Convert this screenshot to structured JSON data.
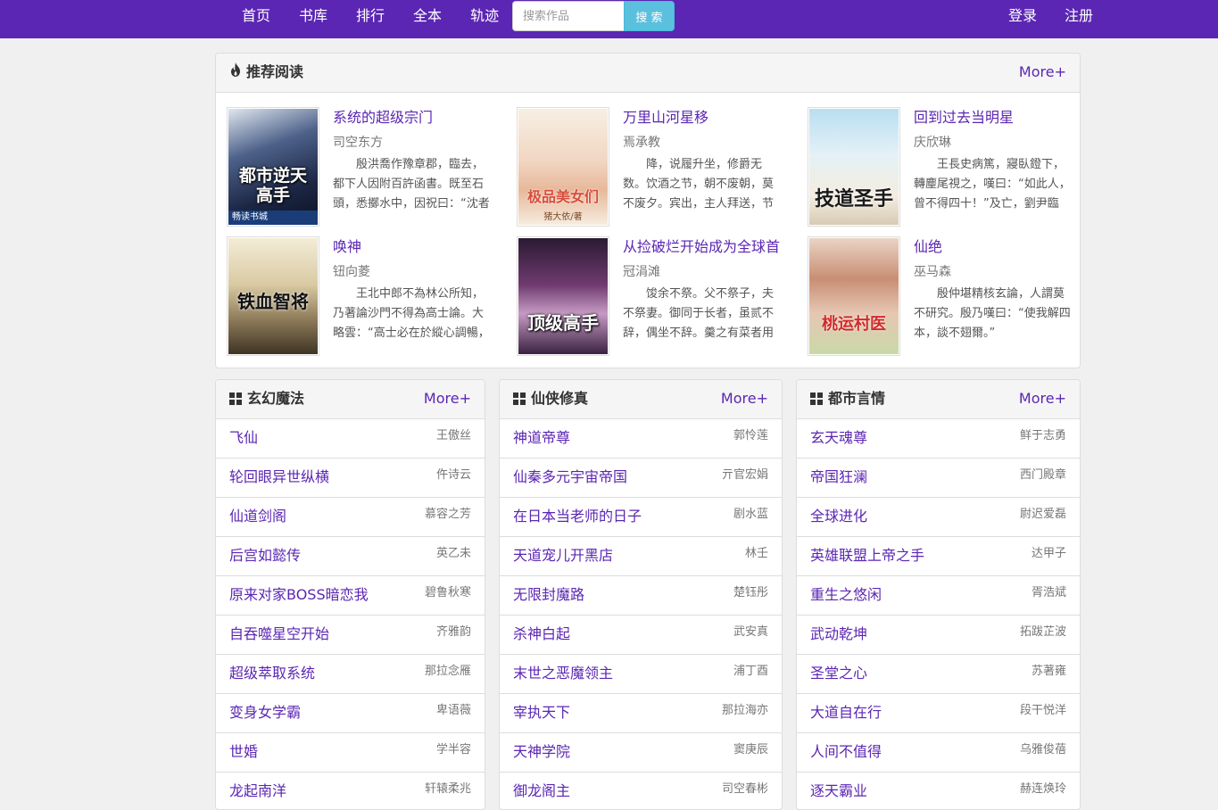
{
  "nav": {
    "items": [
      "首页",
      "书库",
      "排行",
      "全本",
      "轨迹"
    ],
    "search_placeholder": "搜索作品",
    "search_button": "搜 索",
    "login": "登录",
    "register": "注册"
  },
  "colors": {
    "accent": "#5b26b3",
    "search_button": "#5bc0de"
  },
  "recommend": {
    "title": "推荐阅读",
    "icon": "fire-icon",
    "more": "More+",
    "books": [
      {
        "title": "系统的超级宗门",
        "author": "司空东方",
        "intro": "殷洪喬作豫章郡，臨去，都下人因附百許函書。既至石頭，悉擲水中，因祝曰：“沈者",
        "cover_text": "都市逆天高手",
        "cover_badge": "畅读书城"
      },
      {
        "title": "万里山河星移",
        "author": "焉承教",
        "intro": "降，说履升坐，修爵无数。饮酒之节，朝不废朝，莫不废夕。宾出，主人拜送，节",
        "cover_text": "极品美女们",
        "cover_badge": "猪大依/著"
      },
      {
        "title": "回到过去当明星",
        "author": "庆欣琳",
        "intro": "王長史病篤，寢臥鐙下，轉麈尾視之，嘆曰：“如此人，曾不得四十！”及亡，劉尹臨",
        "cover_text": "技道圣手",
        "cover_badge": ""
      },
      {
        "title": "唤神",
        "author": "钮向菱",
        "intro": "王北中郎不為林公所知，乃著論沙門不得為高士論。大略雲：“高士必在於縱心調暢，",
        "cover_text": "铁血智将",
        "cover_badge": ""
      },
      {
        "title": "从捡破烂开始成为全球首",
        "author": "冠涓滩",
        "intro": "馂余不祭。父不祭子，夫不祭妻。御同于长者，虽贰不辞，偶坐不辞。羹之有菜者用",
        "cover_text": "顶级高手",
        "cover_badge": ""
      },
      {
        "title": "仙绝",
        "author": "巫马森",
        "intro": "殷仲堪精核玄論，人謂莫不研究。殷乃嘆曰：“使我解四本，談不翅爾。”",
        "cover_text": "桃运村医",
        "cover_badge": ""
      }
    ]
  },
  "lists": [
    {
      "title": "玄幻魔法",
      "more": "More+",
      "items": [
        {
          "title": "飞仙",
          "author": "王傲丝"
        },
        {
          "title": "轮回眼异世纵横",
          "author": "仵诗云"
        },
        {
          "title": "仙道剑阁",
          "author": "慕容之芳"
        },
        {
          "title": "后宫如懿传",
          "author": "英乙未"
        },
        {
          "title": "原来对家BOSS暗恋我",
          "author": "碧鲁秋寒"
        },
        {
          "title": "自吞噬星空开始",
          "author": "齐雅韵"
        },
        {
          "title": "超级萃取系统",
          "author": "那拉念雁"
        },
        {
          "title": "变身女学霸",
          "author": "卑语薇"
        },
        {
          "title": "世婚",
          "author": "学半容"
        },
        {
          "title": "龙起南洋",
          "author": "轩辕柔兆"
        }
      ]
    },
    {
      "title": "仙侠修真",
      "more": "More+",
      "items": [
        {
          "title": "神道帝尊",
          "author": "郭怜莲"
        },
        {
          "title": "仙秦多元宇宙帝国",
          "author": "亓官宏娟"
        },
        {
          "title": "在日本当老师的日子",
          "author": "剧水蓝"
        },
        {
          "title": "天道宠儿开黑店",
          "author": "林壬"
        },
        {
          "title": "无限封魔路",
          "author": "楚钰彤"
        },
        {
          "title": "杀神白起",
          "author": "武安真"
        },
        {
          "title": "末世之恶魔领主",
          "author": "浦丁酉"
        },
        {
          "title": "宰执天下",
          "author": "那拉海亦"
        },
        {
          "title": "天神学院",
          "author": "窦庚辰"
        },
        {
          "title": "御龙阁主",
          "author": "司空春彬"
        }
      ]
    },
    {
      "title": "都市言情",
      "more": "More+",
      "items": [
        {
          "title": "玄天魂尊",
          "author": "鲜于志勇"
        },
        {
          "title": "帝国狂澜",
          "author": "西门殿章"
        },
        {
          "title": "全球进化",
          "author": "尉迟爱磊"
        },
        {
          "title": "英雄联盟上帝之手",
          "author": "达甲子"
        },
        {
          "title": "重生之悠闲",
          "author": "胥浩斌"
        },
        {
          "title": "武动乾坤",
          "author": "拓跋芷波"
        },
        {
          "title": "圣堂之心",
          "author": "苏著雍"
        },
        {
          "title": "大道自在行",
          "author": "段干悦洋"
        },
        {
          "title": "人间不值得",
          "author": "乌雅俊蓓"
        },
        {
          "title": "逐天霸业",
          "author": "赫连焕玲"
        }
      ]
    }
  ]
}
